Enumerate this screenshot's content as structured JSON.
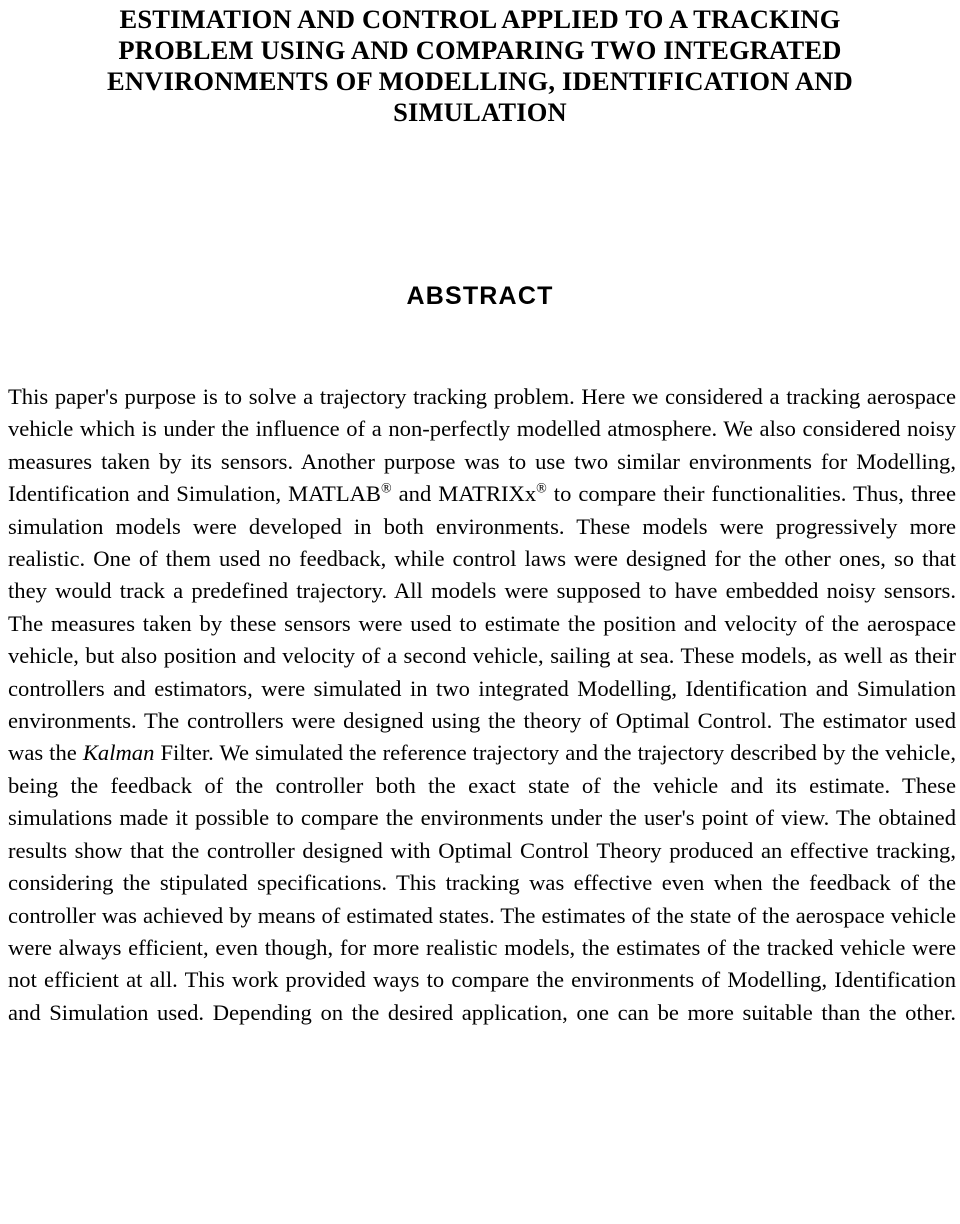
{
  "document": {
    "title_lines": [
      "ESTIMATION AND CONTROL APPLIED TO A TRACKING",
      "PROBLEM USING AND COMPARING TWO INTEGRATED",
      "ENVIRONMENTS OF MODELLING, IDENTIFICATION AND",
      "SIMULATION"
    ],
    "title_full": "ESTIMATION AND CONTROL APPLIED TO A TRACKING PROBLEM USING AND COMPARING TWO INTEGRATED ENVIRONMENTS OF MODELLING, IDENTIFICATION AND SIMULATION",
    "section_heading": "ABSTRACT",
    "abstract": {
      "part1": "This paper's purpose is to solve a trajectory tracking problem. Here we considered a tracking aerospace vehicle which is under the influence of a non-perfectly modelled atmosphere. We also considered noisy measures taken by its sensors. Another purpose was to use two similar environments for Modelling, Identification and Simulation, MATLAB",
      "reg1": "®",
      "part2": " and MATRIXx",
      "reg2": "®",
      "part3": " to compare their functionalities. Thus, three simulation models were developed in both environments. These models were progressively more realistic. One of them used no feedback, while control laws were designed for the other ones, so that they would track a predefined trajectory. All models were supposed to have embedded noisy sensors. The measures taken by these sensors were used to estimate the position and velocity of the aerospace vehicle, but also position and velocity of a second vehicle, sailing at sea. These models, as well as their controllers and estimators, were simulated in two integrated Modelling, Identification and Simulation environments. The controllers were designed using the theory of Optimal Control. The estimator used was the ",
      "kalman": "Kalman",
      "part4": " Filter. We simulated the reference trajectory and the trajectory described by the vehicle, being the feedback of the controller both the exact state of the vehicle and its estimate. These simulations made it possible to compare the environments under the user's point of view. The obtained results show that the controller designed with Optimal Control Theory produced an effective tracking, considering the stipulated specifications. This tracking was effective even when the feedback of the controller was achieved by means of estimated states. The estimates of the state of the aerospace vehicle were always efficient, even though, for more realistic models, the estimates of the tracked vehicle were not efficient at all. This work provided ways to compare the environments of Modelling, Identification and Simulation used. Depending on the desired application, one can be more suitable than the other."
    },
    "colors": {
      "text": "#000000",
      "background": "#ffffff"
    }
  }
}
